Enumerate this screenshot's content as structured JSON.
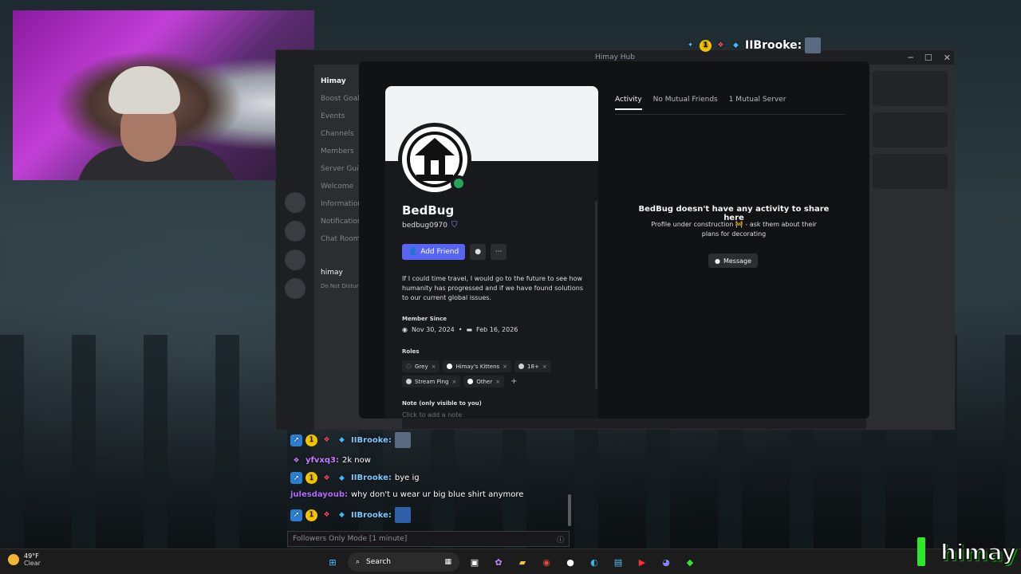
{
  "window": {
    "title": "Himay Hub"
  },
  "server_pane": {
    "name": "Himay",
    "rows": [
      "Boost Goal",
      "Events",
      "Channels",
      "Members",
      "Server Guide",
      "Welcome",
      "Information",
      "Notifications",
      "Chat Room"
    ],
    "user": "himay",
    "user_status": "Do Not Disturb"
  },
  "profile": {
    "display_name": "BedBug",
    "username": "bedbug0970",
    "add_friend_label": "Add Friend",
    "bio": "If I could time travel, I would go to the future to see how humanity has progressed and if we have found solutions to our current global issues.",
    "member_since_label": "Member Since",
    "member_since_discord": "Nov 30, 2024",
    "member_since_server": "Feb 16, 2026",
    "roles_label": "Roles",
    "roles": [
      {
        "name": "Grey",
        "color": "#2b2d31"
      },
      {
        "name": "Himay's Kittens",
        "color": "#ffffff"
      },
      {
        "name": "18+",
        "color": "#d0d0d0"
      },
      {
        "name": "Stream Ping",
        "color": "#d0d0d0"
      },
      {
        "name": "Other",
        "color": "#ffffff"
      }
    ],
    "note_label": "Note (only visible to you)",
    "note_placeholder": "Click to add a note"
  },
  "tabs": [
    "Activity",
    "No Mutual Friends",
    "1 Mutual Server"
  ],
  "activity": {
    "empty_title": "BedBug doesn't have any activity to share here",
    "empty_sub": "Profile under construction 🚧 - ask them about their plans for decorating",
    "message_label": "Message"
  },
  "overlay_user": "IIBrooke:",
  "chat": {
    "lines": [
      {
        "user": "IIBrooke:",
        "text": "",
        "color": "#7ec8ff",
        "emote": true
      },
      {
        "user": "yfvxq3:",
        "text": "2k now",
        "color": "#c77dff",
        "emote": false
      },
      {
        "user": "IIBrooke:",
        "text": "bye ig",
        "color": "#7ec8ff",
        "emote": false
      },
      {
        "user": "julesdayoub:",
        "text": "why don't u wear ur big blue shirt anymore",
        "color": "#b36bff",
        "emote": false
      },
      {
        "user": "IIBrooke:",
        "text": "",
        "color": "#7ec8ff",
        "emote": true
      }
    ],
    "input_placeholder": "Followers Only Mode [1 minute]"
  },
  "taskbar": {
    "temp": "49°F",
    "condition": "Clear",
    "search_label": "Search"
  },
  "brand": {
    "logo_text": "himay",
    "accent": "#5865f2",
    "online": "#23a55a"
  }
}
